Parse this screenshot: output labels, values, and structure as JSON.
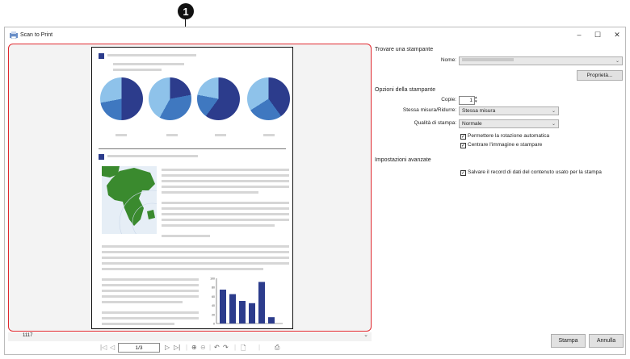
{
  "callout": {
    "number": "1"
  },
  "window": {
    "title": "Scan to Print",
    "controls": [
      "–",
      "☐",
      "✕"
    ]
  },
  "preview": {
    "zoom_value": "1117",
    "page_indicator": "1/3",
    "chart_bar_ticks": [
      "100",
      "80",
      "60",
      "40",
      "20",
      "0"
    ],
    "chart_bar_values": [
      75,
      65,
      50,
      45,
      92,
      14
    ]
  },
  "panel": {
    "printer_section": "Trovare una stampante",
    "name_label": "Nome:",
    "name_value": "",
    "properties_button": "Proprietà...",
    "options_section": "Opzioni della stampante",
    "copies_label": "Copie:",
    "copies_value": "1",
    "size_label": "Stessa misura/Ridurre:",
    "size_value": "Stessa misura",
    "quality_label": "Qualità di stampa:",
    "quality_value": "Normale",
    "auto_rotate": "Permettere la rotazione automatica",
    "center_image": "Centrare l'immagine e stampare",
    "advanced_section": "Impostazioni avanzate",
    "save_record": "Salvare il record di dati del contenuto usato per la stampa",
    "print_button": "Stampa",
    "cancel_button": "Annulla"
  },
  "colors": {
    "accent_red": "#e0282e",
    "page_dark_blue": "#2c3c8c",
    "pie_mid": "#3f78c0",
    "pie_light": "#8ec2ea",
    "map_green": "#3a8a2e"
  }
}
